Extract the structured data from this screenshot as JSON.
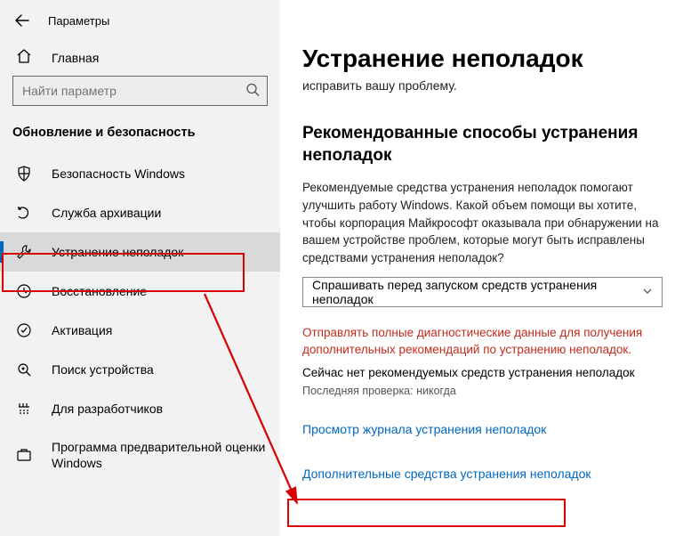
{
  "header": {
    "title": "Параметры"
  },
  "home": {
    "label": "Главная"
  },
  "search": {
    "placeholder": "Найти параметр"
  },
  "section": {
    "label": "Обновление и безопасность"
  },
  "sidebar": {
    "items": [
      {
        "label": "Безопасность Windows"
      },
      {
        "label": "Служба архивации"
      },
      {
        "label": "Устранение неполадок"
      },
      {
        "label": "Восстановление"
      },
      {
        "label": "Активация"
      },
      {
        "label": "Поиск устройства"
      },
      {
        "label": "Для разработчиков"
      },
      {
        "label": "Программа предварительной оценки Windows"
      }
    ]
  },
  "main": {
    "title": "Устранение неполадок",
    "sub": "исправить вашу проблему.",
    "h2": "Рекомендованные способы устранения неполадок",
    "para": "Рекомендуемые средства устранения неполадок помогают улучшить работу Windows. Какой объем помощи вы хотите, чтобы корпорация Майкрософт оказывала при обнаружении на вашем устройстве проблем, которые могут быть исправлены средствами устранения неполадок?",
    "dropdown": "Спрашивать перед запуском средств устранения неполадок",
    "warn": "Отправлять полные диагностические данные для получения дополнительных рекомендаций по устранению неполадок.",
    "none": "Сейчас нет рекомендуемых средств устранения неполадок",
    "last": "Последняя проверка: никогда",
    "link1": "Просмотр журнала устранения неполадок",
    "link2": "Дополнительные средства устранения неполадок"
  }
}
